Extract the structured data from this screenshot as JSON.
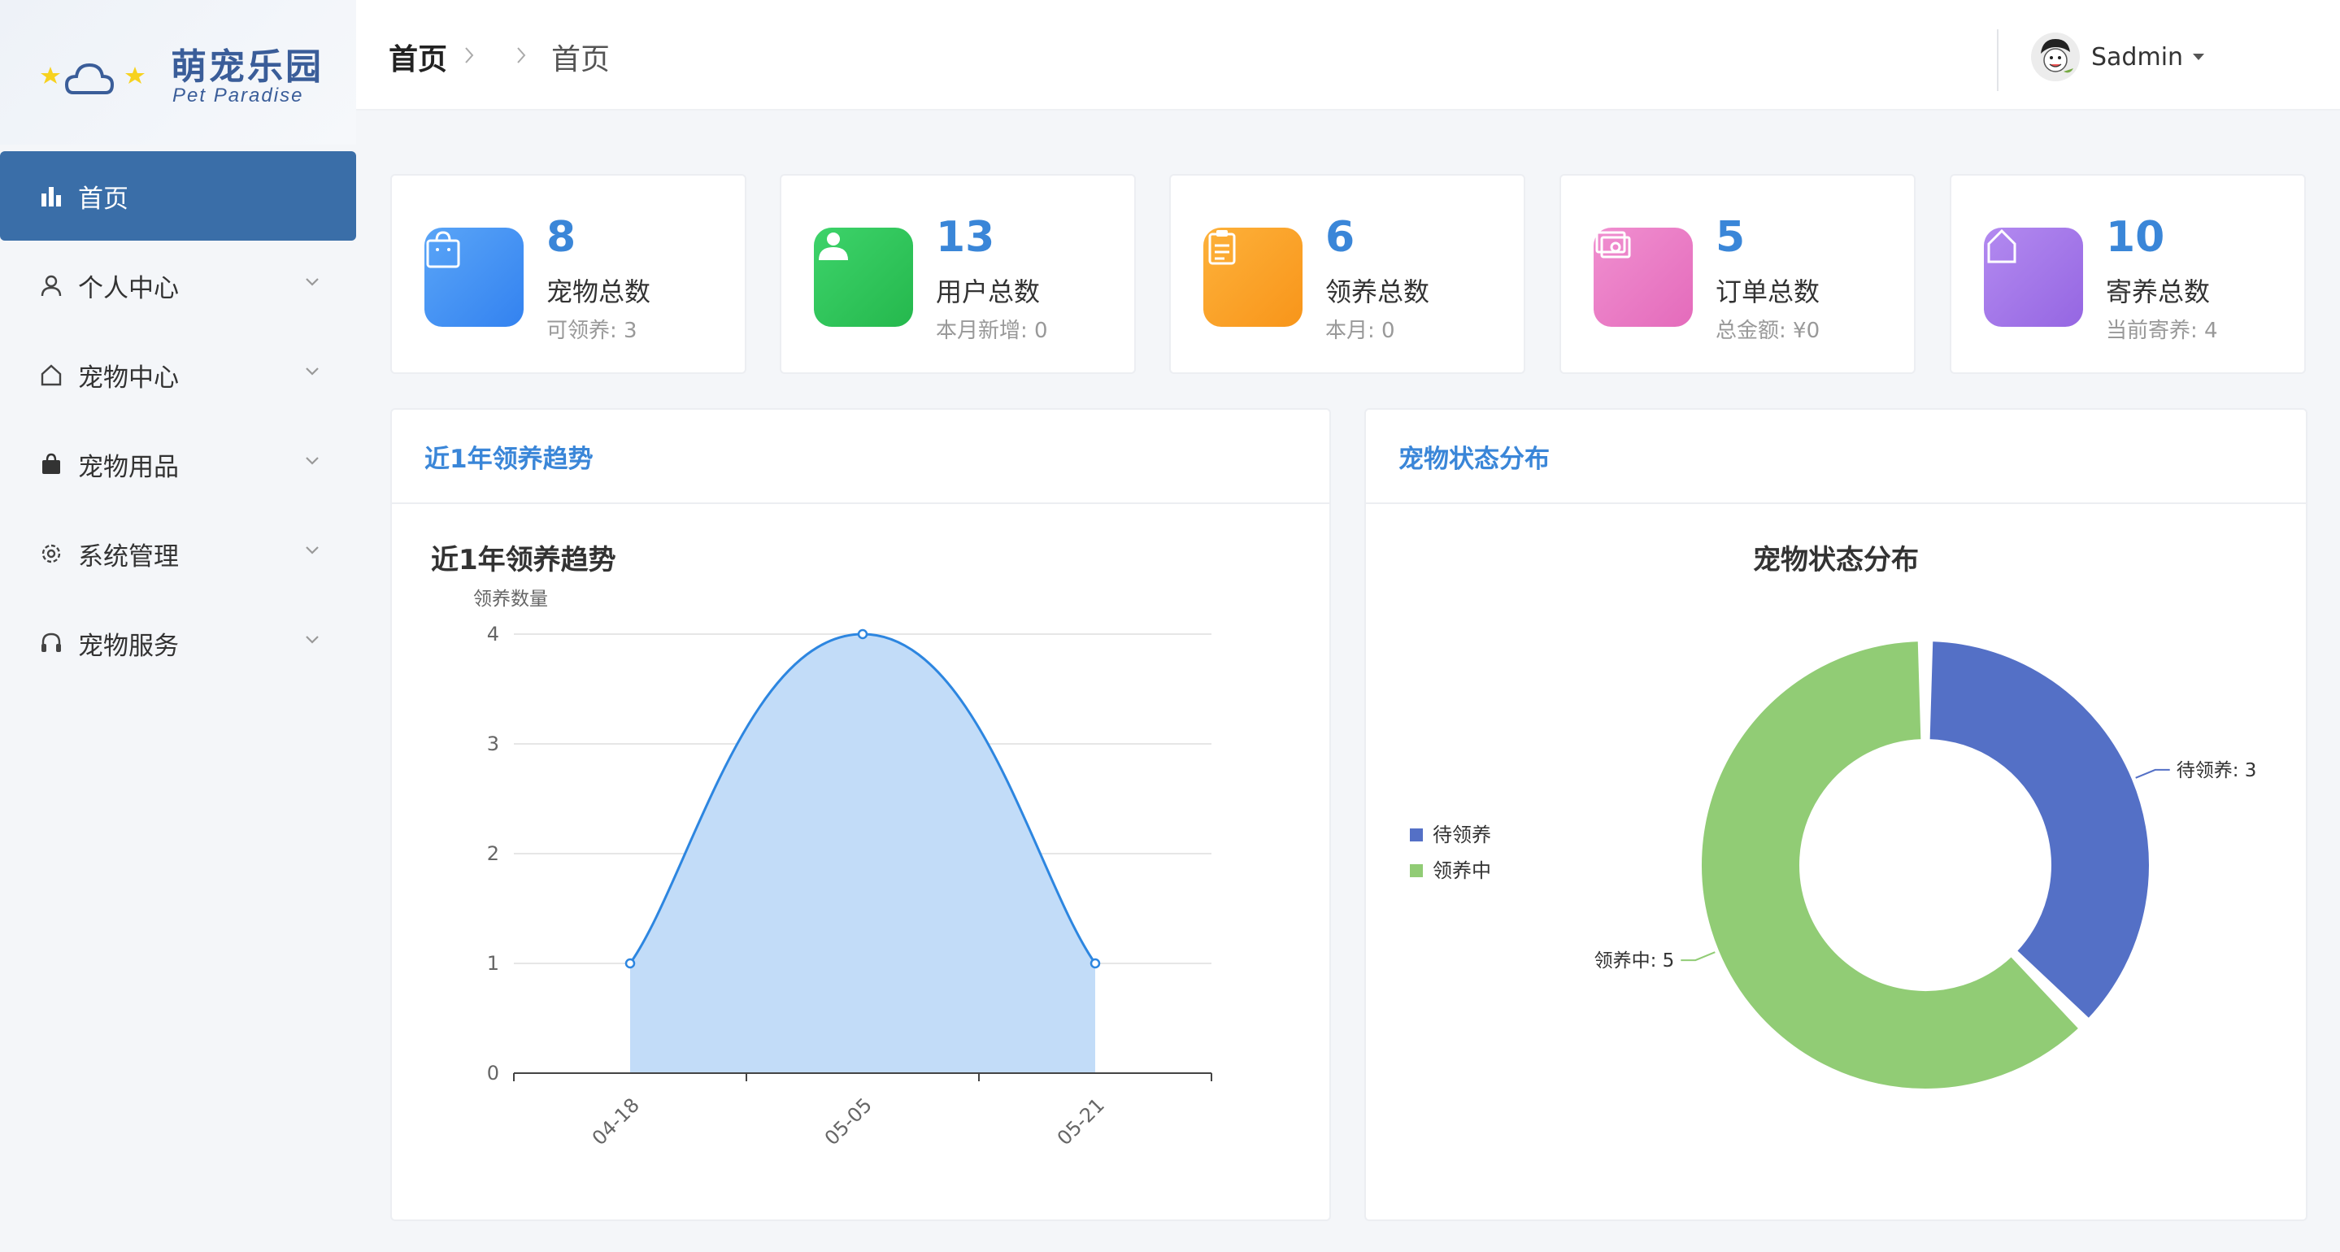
{
  "brand": {
    "title": "萌宠乐园",
    "subtitle": "Pet Paradise"
  },
  "sidebar": {
    "items": [
      {
        "label": "首页",
        "icon": "bar-chart-icon",
        "active": true
      },
      {
        "label": "个人中心",
        "icon": "user-icon"
      },
      {
        "label": "宠物中心",
        "icon": "house-icon"
      },
      {
        "label": "宠物用品",
        "icon": "bag-icon"
      },
      {
        "label": "系统管理",
        "icon": "gear-icon"
      },
      {
        "label": "宠物服务",
        "icon": "headset-icon"
      }
    ]
  },
  "header": {
    "breadcrumb": [
      "首页",
      "首页"
    ],
    "user": {
      "name": "Sadmin"
    }
  },
  "stats": [
    {
      "value": "8",
      "label": "宠物总数",
      "sub": "可领养: 3",
      "icon": "shopping-bag-icon",
      "color": "#3f8ef3"
    },
    {
      "value": "13",
      "label": "用户总数",
      "sub": "本月新增: 0",
      "icon": "person-icon",
      "color": "#2ec55a"
    },
    {
      "value": "6",
      "label": "领养总数",
      "sub": "本月: 0",
      "icon": "clipboard-icon",
      "color": "#fb9f1f"
    },
    {
      "value": "5",
      "label": "订单总数",
      "sub": "总金额: ¥0",
      "icon": "money-icon",
      "color": "#e978c3"
    },
    {
      "value": "10",
      "label": "寄养总数",
      "sub": "当前寄养: 4",
      "icon": "home-icon",
      "color": "#a175e8"
    }
  ],
  "panels": {
    "trend": {
      "header": "近1年领养趋势"
    },
    "status": {
      "header": "宠物状态分布"
    }
  },
  "chart_data": [
    {
      "type": "area",
      "title": "近1年领养趋势",
      "ylabel": "领养数量",
      "xlabel": "",
      "categories": [
        "04-18",
        "05-05",
        "05-21"
      ],
      "values": [
        1,
        4,
        1
      ],
      "ylim": [
        0,
        4
      ],
      "yticks": [
        "0",
        "1",
        "2",
        "3",
        "4"
      ],
      "smooth": true,
      "grid": true,
      "line_color": "#2d86e0",
      "fill_color": "#c2dcf8"
    },
    {
      "type": "pie",
      "title": "宠物状态分布",
      "donut": true,
      "legend_position": "left",
      "slices": [
        {
          "name": "待领养",
          "value": 3,
          "color": "#5470c6",
          "label": "待领养: 3"
        },
        {
          "name": "领养中",
          "value": 5,
          "color": "#91cc75",
          "label": "领养中: 5"
        }
      ]
    }
  ]
}
